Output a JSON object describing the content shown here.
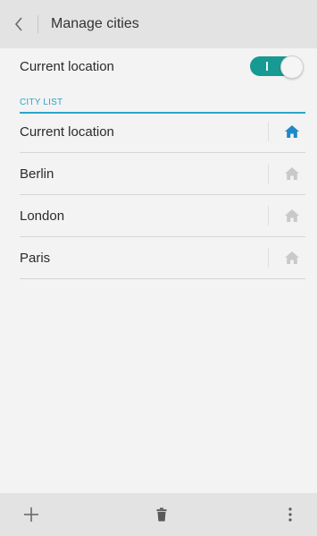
{
  "header": {
    "title": "Manage cities",
    "back_icon": "chevron-left-icon"
  },
  "settings": {
    "current_location_label": "Current location",
    "current_location_enabled": true
  },
  "city_list": {
    "section_title": "CITY LIST",
    "items": [
      {
        "name": "Current location",
        "is_home": true
      },
      {
        "name": "Berlin",
        "is_home": false
      },
      {
        "name": "London",
        "is_home": false
      },
      {
        "name": "Paris",
        "is_home": false
      }
    ]
  },
  "bottom_bar": {
    "icons": [
      "plus-icon",
      "trash-icon",
      "more-vertical-icon"
    ]
  },
  "colors": {
    "accent": "#2aa6c7",
    "toggle_on": "#169a93",
    "home_active": "#1f88c9",
    "home_inactive": "#c9c9c9"
  }
}
